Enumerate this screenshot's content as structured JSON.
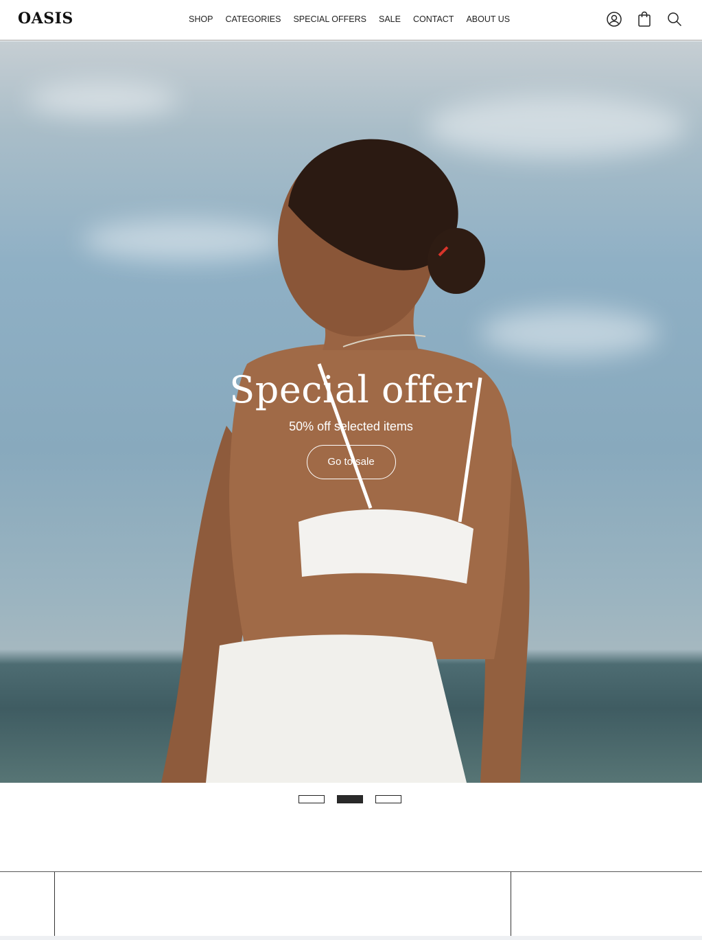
{
  "header": {
    "logo": "OASIS",
    "nav": [
      "SHOP",
      "CATEGORIES",
      "SPECIAL OFFERS",
      "SALE",
      "CONTACT",
      "ABOUT US"
    ],
    "icons": [
      "user-icon",
      "shopping-bag-icon",
      "search-icon"
    ]
  },
  "hero": {
    "title": "Special offer",
    "subtitle": "50% off selected items",
    "button_label": "Go to sale"
  },
  "carousel": {
    "slide_count": 3,
    "active_index": 1
  },
  "colors": {
    "text_dark": "#1a1a1a",
    "hero_text": "#ffffff",
    "active_indicator": "#2a2a2a"
  }
}
